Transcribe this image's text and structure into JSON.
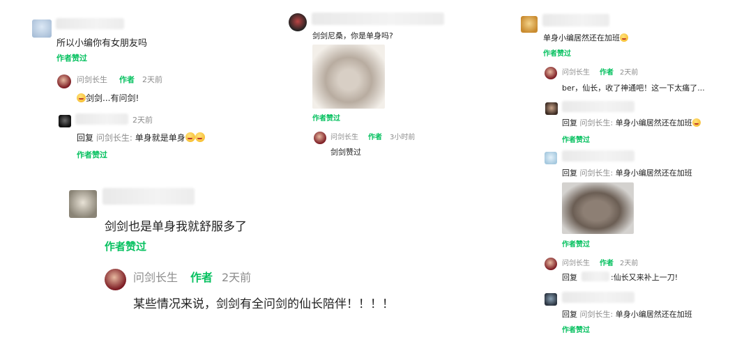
{
  "col1": {
    "c1_text": "所以小编你有女朋友吗",
    "c1_liked": "作者赞过",
    "r1_name": "问剑长生",
    "r1_author": "作者",
    "r1_time": "2天前",
    "r1_text": "剑剑...有问剑!",
    "r2_time": "2天前",
    "r2_reply": "回复",
    "r2_target": "问剑长生:",
    "r2_text": "单身就是单身",
    "r2_liked": "作者赞过",
    "c2_text": "剑剑也是单身我就舒服多了",
    "c2_liked": "作者赞过",
    "r3_name": "问剑长生",
    "r3_author": "作者",
    "r3_time": "2天前",
    "r3_text": "某些情况来说，剑剑有全问剑的仙长陪伴！！！！"
  },
  "col2": {
    "c1_text": "剑剑尼桑，你是单身吗?",
    "c1_liked": "作者赞过",
    "r1_name": "问剑长生",
    "r1_author": "作者",
    "r1_time": "3小时前",
    "r1_text": "剑剑赞过"
  },
  "col3": {
    "c1_text": "单身小编居然还在加班",
    "c1_liked": "作者赞过",
    "r1_name": "问剑长生",
    "r1_author": "作者",
    "r1_time": "2天前",
    "r1_text": "ber，仙长，收了神通吧！这一下太痛了...",
    "r2_reply": "回复",
    "r2_target": "问剑长生:",
    "r2_text": "单身小编居然还在加班",
    "r2_liked": "作者赞过",
    "r3_reply": "回复",
    "r3_target": "问剑长生:",
    "r3_text": "单身小编居然还在加班",
    "r3_liked": "作者赞过",
    "r4_name": "问剑长生",
    "r4_author": "作者",
    "r4_time": "2天前",
    "r4_reply": "回复",
    "r4_text": ":仙长又来补上一刀!",
    "r5_reply": "回复",
    "r5_target": "问剑长生:",
    "r5_text": "单身小编居然还在加班",
    "r5_liked": "作者赞过"
  },
  "icons": [
    "anime-avatar",
    "author-avatar",
    "cat-face-emoji",
    "cry-face-emoji",
    "hamster-photo",
    "rat-photo"
  ],
  "colors": {
    "accent": "#07c160",
    "muted": "#8c8c8c"
  }
}
